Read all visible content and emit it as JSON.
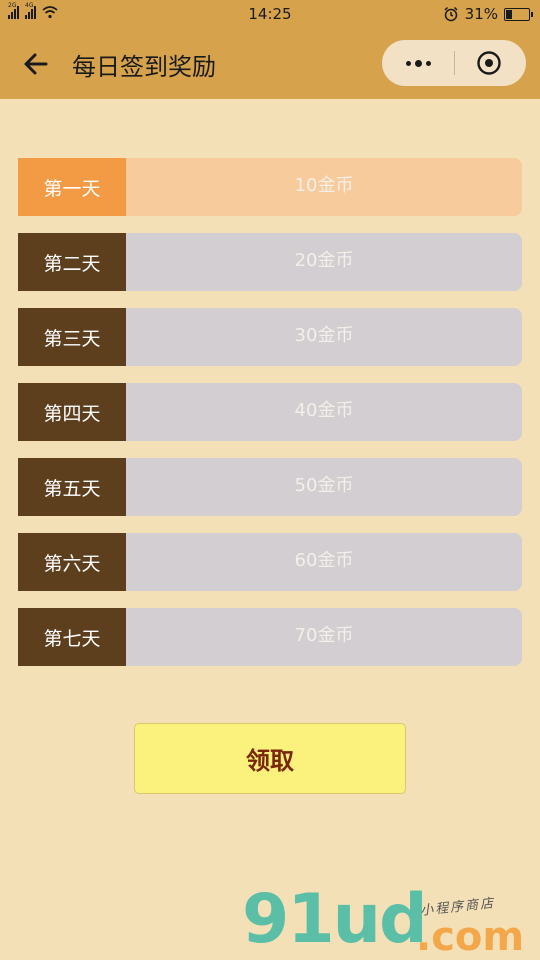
{
  "status_bar": {
    "network_left": "2G",
    "network_right": "4G",
    "time": "14:25",
    "battery_percent": "31%",
    "battery_level": 0.31
  },
  "nav": {
    "title": "每日签到奖励"
  },
  "rewards": [
    {
      "day": "第一天",
      "amount": "10金币",
      "active": true
    },
    {
      "day": "第二天",
      "amount": "20金币",
      "active": false
    },
    {
      "day": "第三天",
      "amount": "30金币",
      "active": false
    },
    {
      "day": "第四天",
      "amount": "40金币",
      "active": false
    },
    {
      "day": "第五天",
      "amount": "50金币",
      "active": false
    },
    {
      "day": "第六天",
      "amount": "60金币",
      "active": false
    },
    {
      "day": "第七天",
      "amount": "70金币",
      "active": false
    }
  ],
  "claim_button": {
    "label": "领取"
  },
  "watermark": {
    "logo": "91ud",
    "suffix": ".com",
    "tagline": "小程序商店"
  },
  "colors": {
    "header": "#d6a24c",
    "page_bg": "#f4e0b6",
    "day_label": "#5d3f1e",
    "day_label_active": "#f39a45",
    "reward_bar": "#d2ced1",
    "reward_bar_active": "#f8cb9c",
    "claim_bg": "#fbf17d",
    "claim_text": "#7a2608"
  }
}
